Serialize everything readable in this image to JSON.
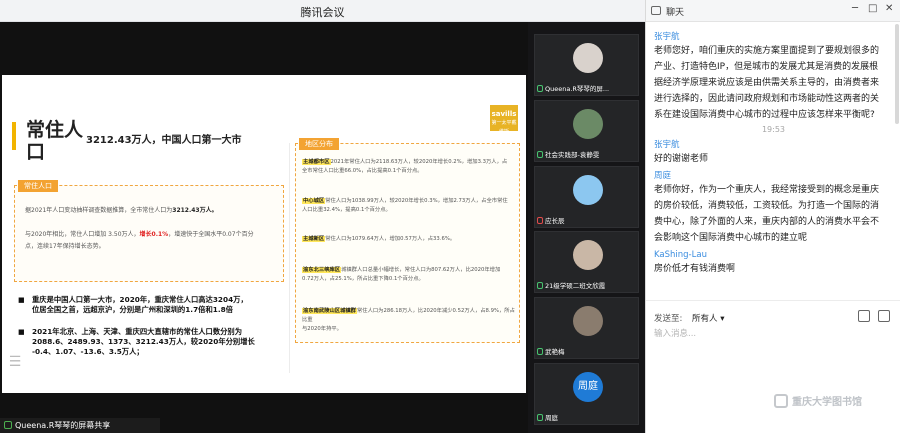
{
  "window": {
    "title": "腾讯会议"
  },
  "slide": {
    "big_title": "常住人口",
    "headline": "3212.43万人，中国人口第一大市",
    "logo_text": "savills",
    "logo_sub": "第一太平戴维斯",
    "left_box": {
      "tag": "常住人口",
      "para1_a": "据2021年人口变动抽样调查数据推算，全市常住人口为",
      "para1_b": "3212.43万人。",
      "para2_a": "与2020年相比，常住人口增加 3.50万人，",
      "para2_red": "增长0.1%",
      "para2_b": "，增速快于全国水平0.07个百分",
      "para3": "点，连续17年保持增长态势。"
    },
    "bullets": [
      {
        "lines": [
          "重庆是中国人口第一大市，2020年，重庆常住人口高达3204万，",
          "位居全国之首，远超京沪，分别是广州和深圳的1.7倍和1.8倍"
        ]
      },
      {
        "lines": [
          "2021年北京、上海、天津、重庆四大直辖市的常住人口数分别为",
          "2088.6、2489.93、1373、3212.43万人，较2020年分别增长",
          "-0.4、1.07、-13.6、3.5万人；"
        ]
      }
    ],
    "right_box": {
      "tag": "地区分布",
      "districts": [
        {
          "name": "主城都市区",
          "l1": "2021年常住人口为2118.63万人，较2020年增长0.2%，增加3.3万人，占",
          "l2": "全市常住人口比重66.0%，占比提高0.1个百分点。"
        },
        {
          "name": "中心城区",
          "l1": "常住人口为1038.99万人，较2020年增长0.3%，增加2.73万人，占全市常住",
          "l2": "人口比重32.4%，提高0.1个百分点。"
        },
        {
          "name": "主城新区",
          "l1": "常住人口为1079.64万人，增加0.57万人，占33.6%。",
          "l2": ""
        },
        {
          "name": "渝东北三峡库区",
          "l1": "城镇群人口总量小幅增长，常住人口为807.62万人，比2020年增加",
          "l2": "0.72万人，占25.1%，所占比重下降0.1个百分点。"
        },
        {
          "name": "渝东南武陵山区城镇群",
          "l1": "常住人口为286.18万人，比2020年减少0.52万人，占8.9%，所占比重",
          "l2": "与2020年持平。"
        }
      ]
    }
  },
  "share_label": "Queena.R琴琴的屏幕共享",
  "participants": [
    {
      "name": "Queena.R琴琴的屏...",
      "mic": "on",
      "avatar_color": "#d9d2cc"
    },
    {
      "name": "社会实践部-袁静雯",
      "mic": "on",
      "avatar_color": "#6b8a66"
    },
    {
      "name": "应长辰",
      "mic": "off",
      "avatar_color": "#8cc7f0"
    },
    {
      "name": "21级学硕二班文欣霞",
      "mic": "on",
      "avatar_color": "#c9b7a6"
    },
    {
      "name": "武艳梅",
      "mic": "on",
      "avatar_color": "#8a7c6e"
    },
    {
      "name": "周庭",
      "mic": "on",
      "avatar_color": "#1f7bd6",
      "avatar_text": "周庭"
    }
  ],
  "chat": {
    "title": "聊天",
    "controls": {
      "minimize": "─",
      "restore": "□",
      "close": "✕"
    },
    "messages": [
      {
        "sender": "张宇航",
        "lines": [
          "老师您好，咱们重庆的实施方案里面提到了要规划很多的",
          "产业、打造特色IP，但是城市的发展尤其是消费的发展根",
          "据经济学原理来说应该是由供需关系主导的，由消费者来",
          "进行选择的，因此请问政府规划和市场能动性这两者的关",
          "系在建设国际消费中心城市的过程中应该怎样来平衡呢?"
        ]
      },
      {
        "time": "19:53"
      },
      {
        "sender": "张宇航",
        "lines": [
          "好的谢谢老师"
        ]
      },
      {
        "sender": "周庭",
        "lines": [
          "老师你好，作为一个重庆人，我经常接受到的概念是重庆",
          "的房价较低，消费较低，工资较低。为打造一个国际的消",
          "费中心，除了外面的人来，重庆内部的人的消费水平会不",
          "会影响这个国际消费中心城市的建立呢"
        ]
      },
      {
        "sender": "KaShing-Lau",
        "lines": [
          "房价低才有钱消费啊"
        ]
      }
    ],
    "send_to_label": "发送至:",
    "recipient": "所有人 ▾",
    "input_placeholder": "输入消息...",
    "watermark": "重庆大学图书馆"
  }
}
